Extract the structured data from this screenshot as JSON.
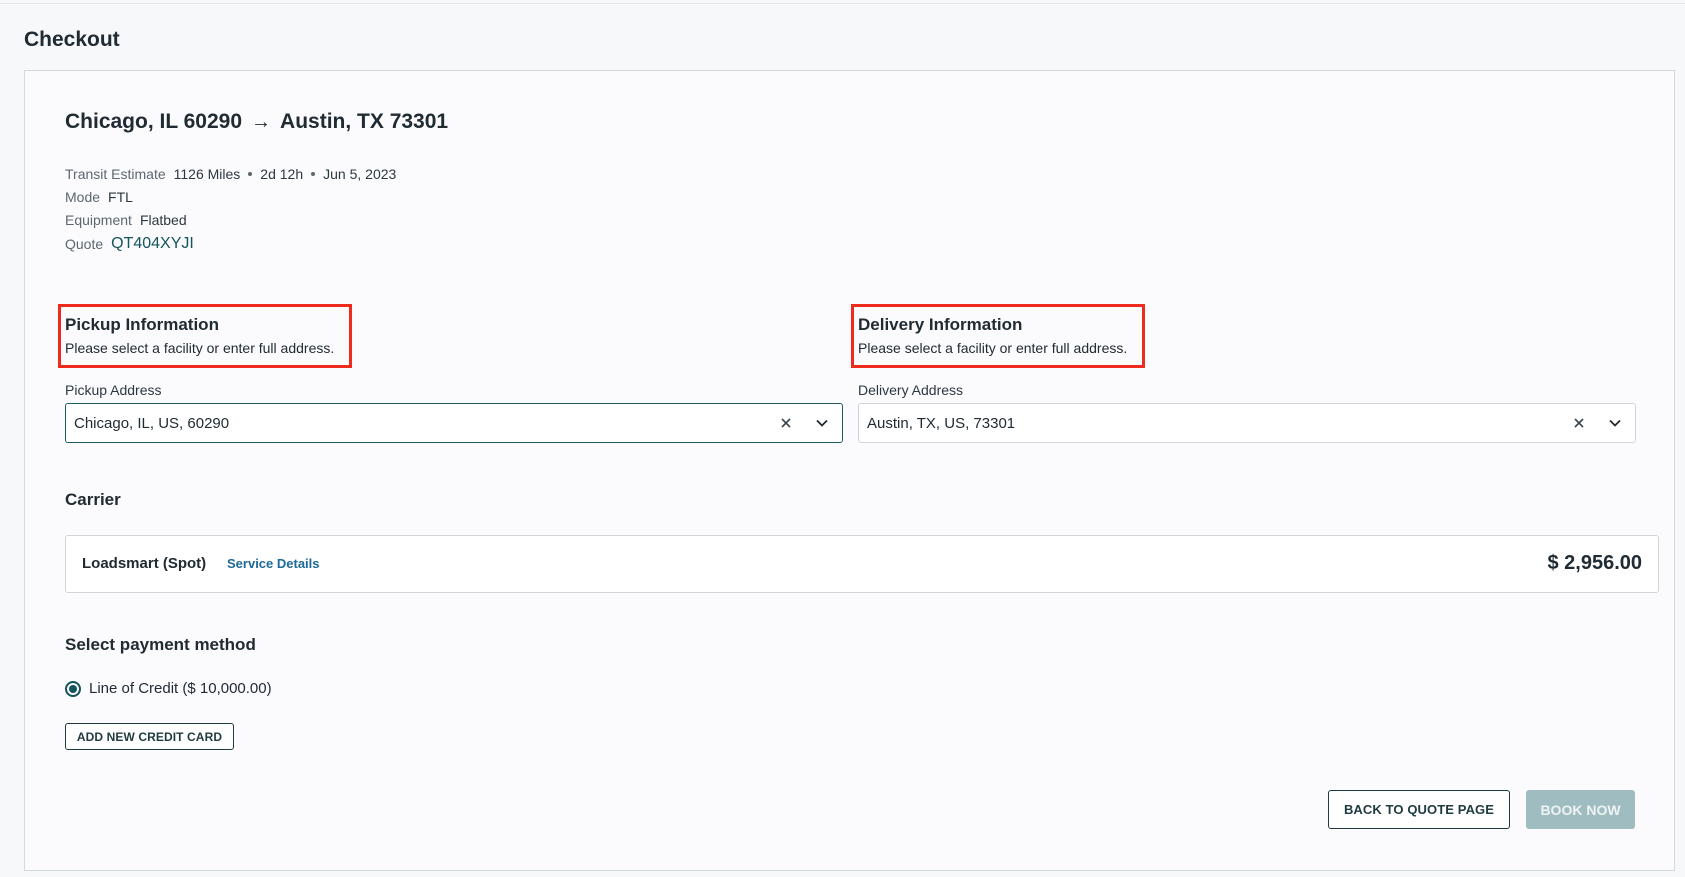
{
  "page": {
    "title": "Checkout"
  },
  "route": {
    "origin": "Chicago, IL 60290",
    "arrow": "→",
    "destination": "Austin, TX 73301"
  },
  "details": {
    "transit_label": "Transit Estimate",
    "transit_miles": "1126 Miles",
    "transit_duration": "2d 12h",
    "transit_date": "Jun 5, 2023",
    "mode_label": "Mode",
    "mode_value": "FTL",
    "equipment_label": "Equipment",
    "equipment_value": "Flatbed",
    "quote_label": "Quote",
    "quote_value": "QT404XYJI"
  },
  "pickup": {
    "title": "Pickup Information",
    "subtitle": "Please select a facility or enter full address.",
    "address_label": "Pickup Address",
    "address_value": "Chicago, IL, US, 60290"
  },
  "delivery": {
    "title": "Delivery Information",
    "subtitle": "Please select a facility or enter full address.",
    "address_label": "Delivery Address",
    "address_value": "Austin, TX, US, 73301"
  },
  "carrier": {
    "section_title": "Carrier",
    "name": "Loadsmart (Spot)",
    "service_details_link": "Service Details",
    "price": "$ 2,956.00"
  },
  "payment": {
    "section_title": "Select payment method",
    "option_label": "Line of Credit ($ 10,000.00)",
    "add_card_button": "ADD NEW CREDIT CARD"
  },
  "actions": {
    "back_button": "BACK TO QUOTE PAGE",
    "book_button": "BOOK NOW"
  },
  "colors": {
    "accent": "#14545c",
    "highlight": "#ee2b1c",
    "link": "#1d6a9a",
    "disabled_button": "#9fbcc1"
  },
  "icons": {
    "route_arrow": "arrow-right-icon",
    "clear": "close-icon",
    "dropdown": "chevron-down-icon"
  }
}
